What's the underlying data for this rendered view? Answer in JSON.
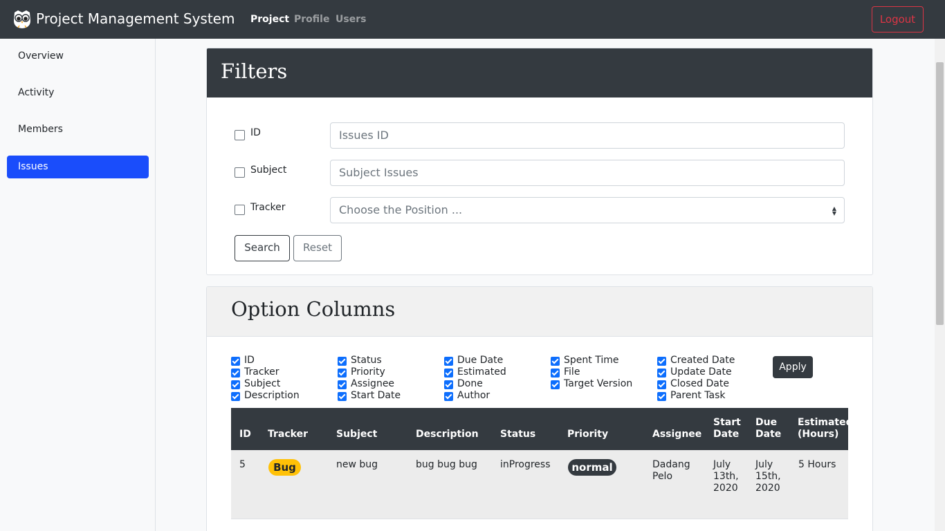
{
  "navbar": {
    "brand": "Project Management System",
    "links": [
      "Project",
      "Profile",
      "Users"
    ],
    "logout": "Logout"
  },
  "sidebar": {
    "items": [
      "Overview",
      "Activity",
      "Members",
      "Issues"
    ],
    "active": "Issues"
  },
  "filters": {
    "title": "Filters",
    "id_label": "ID",
    "id_placeholder": "Issues ID",
    "subject_label": "Subject",
    "subject_placeholder": "Subject Issues",
    "tracker_label": "Tracker",
    "tracker_value": "Choose the Position ...",
    "search": "Search",
    "reset": "Reset"
  },
  "options": {
    "title": "Option Columns",
    "columns": [
      [
        "ID",
        "Tracker",
        "Subject",
        "Description"
      ],
      [
        "Status",
        "Priority",
        "Assignee",
        "Start Date"
      ],
      [
        "Due Date",
        "Estimated",
        "Done",
        "Author"
      ],
      [
        "Spent Time",
        "File",
        "Target Version"
      ],
      [
        "Created Date",
        "Update Date",
        "Closed Date",
        "Parent Task"
      ]
    ],
    "apply": "Apply"
  },
  "table": {
    "headers": {
      "id": "ID",
      "tracker": "Tracker",
      "subject": "Subject",
      "description": "Description",
      "status": "Status",
      "priority": "Priority",
      "assignee": "Assignee",
      "start_date_1": "Start",
      "start_date_2": "Date",
      "due_date_1": "Due",
      "due_date_2": "Date",
      "estimated_1": "Estimated",
      "estimated_2": "(Hours)"
    },
    "rows": [
      {
        "id": "5",
        "tracker": "Bug",
        "subject": "new bug",
        "description": "bug bug bug",
        "status": "inProgress",
        "priority": "normal",
        "assignee_1": "Dadang",
        "assignee_2": "Pelo",
        "start_1": "July",
        "start_2": "13th,",
        "start_3": "2020",
        "due_1": "July",
        "due_2": "15th,",
        "due_3": "2020",
        "estimated": "5 Hours"
      }
    ]
  },
  "colors": {
    "navbar": "#343a40",
    "active_sidebar": "#1a4dfb",
    "logout": "#dc3545",
    "badge_warning": "#ffc107",
    "checkbox": "#0d6efd"
  }
}
